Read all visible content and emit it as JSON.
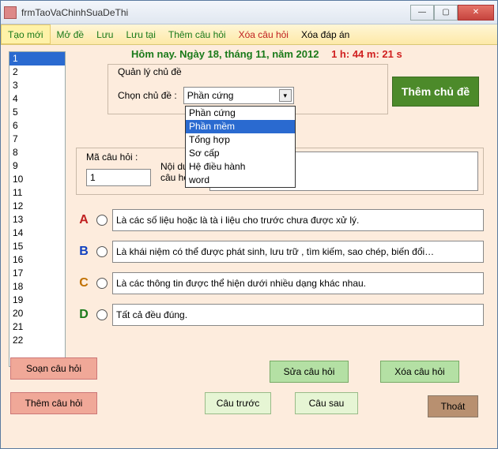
{
  "titlebar": {
    "title": "frmTaoVaChinhSuaDeThi"
  },
  "toolbar": {
    "new": "Tạo mới",
    "open": "Mở đề",
    "save": "Lưu",
    "saveAs": "Lưu tại",
    "addQ": "Thêm câu hỏi",
    "delQ": "Xóa câu hỏi",
    "delA": "Xóa đáp án"
  },
  "dateBar": {
    "date": "Hôm nay. Ngày 18, tháng 11, năm 2012",
    "time": "1 h: 44 m: 21 s"
  },
  "list": {
    "items": [
      "1",
      "2",
      "3",
      "4",
      "5",
      "6",
      "7",
      "8",
      "9",
      "10",
      "11",
      "12",
      "13",
      "14",
      "15",
      "16",
      "17",
      "18",
      "19",
      "20",
      "21",
      "22"
    ],
    "selected": "1"
  },
  "topic": {
    "groupLabel": "Quản lý chủ đề",
    "chooseLabel": "Chọn chủ đề :",
    "selected": "Phần cứng",
    "options": [
      "Phần cứng",
      "Phần mềm",
      "Tổng hợp",
      "Sơ cấp",
      "Hệ điều hành",
      "word"
    ],
    "highlighted": "Phần mềm",
    "addBtn": "Thêm chủ đề"
  },
  "question": {
    "codeLabel": "Mã câu hỏi :",
    "codeValue": "1",
    "contentLabel": "Nội dung\ncâu hỏi :"
  },
  "answers": {
    "A": "Là các số liệu hoặc là tà i liệu cho trước chưa được xử lý.",
    "B": "Là khái niệm có thể được phát sinh, lưu trữ , tìm kiếm, sao chép, biến đổi…",
    "C": "Là các thông tin được thể hiện dưới nhiều dạng khác nhau.",
    "D": "Tất cả đều đúng."
  },
  "buttons": {
    "compose": "Soạn câu hỏi",
    "addQ": "Thêm câu hỏi",
    "editQ": "Sửa câu hỏi",
    "delQ": "Xóa câu hỏi",
    "prevQ": "Câu trước",
    "nextQ": "Câu sau",
    "exit": "Thoát"
  },
  "colors": {
    "accentGreen": "#4c8a2a",
    "highlight": "#2a6ad0",
    "formBg": "#fdecdd"
  }
}
